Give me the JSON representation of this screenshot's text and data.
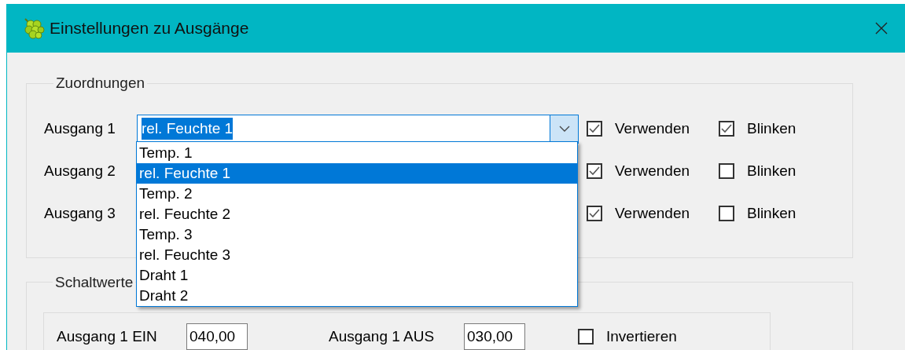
{
  "window": {
    "title": "Einstellungen zu Ausgänge"
  },
  "assignments": {
    "title": "Zuordnungen",
    "rows": [
      {
        "label": "Ausgang 1",
        "combo": {
          "value": "rel. Feuchte 1",
          "text_selected": true,
          "focused": true
        },
        "use": {
          "label": "Verwenden",
          "checked": true
        },
        "blink": {
          "label": "Blinken",
          "checked": true
        }
      },
      {
        "label": "Ausgang 2",
        "use": {
          "label": "Verwenden",
          "checked": true
        },
        "blink": {
          "label": "Blinken",
          "checked": false
        }
      },
      {
        "label": "Ausgang 3",
        "use": {
          "label": "Verwenden",
          "checked": true
        },
        "blink": {
          "label": "Blinken",
          "checked": false
        }
      }
    ]
  },
  "dropdown": {
    "items": [
      {
        "label": "Temp. 1",
        "selected": false
      },
      {
        "label": "rel. Feuchte 1",
        "selected": true
      },
      {
        "label": "Temp. 2",
        "selected": false
      },
      {
        "label": "rel. Feuchte 2",
        "selected": false
      },
      {
        "label": "Temp. 3",
        "selected": false
      },
      {
        "label": "rel. Feuchte 3",
        "selected": false
      },
      {
        "label": "Draht 1",
        "selected": false
      },
      {
        "label": "Draht 2",
        "selected": false
      }
    ]
  },
  "switch_values": {
    "title": "Schaltwerte",
    "rows": [
      {
        "on_label": "Ausgang 1 EIN",
        "on_value": "040,00",
        "off_label": "Ausgang 1 AUS",
        "off_value": "030,00",
        "invert": {
          "label": "Invertieren",
          "checked": false
        }
      }
    ]
  }
}
